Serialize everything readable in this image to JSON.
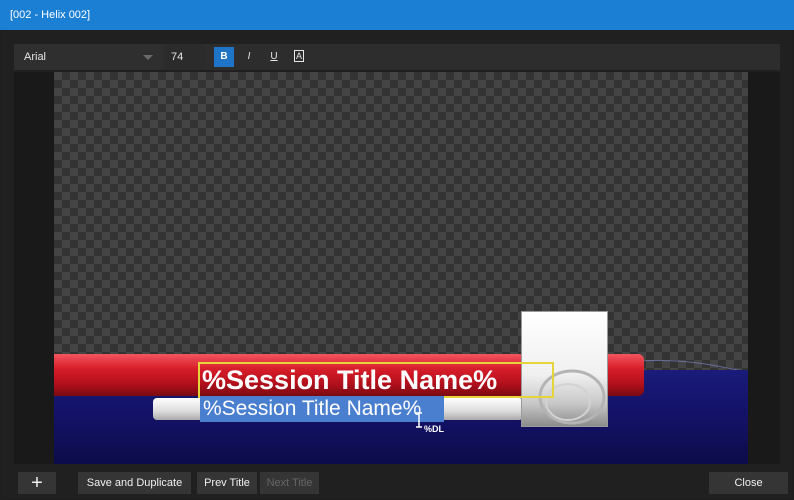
{
  "window": {
    "title": "[002 - Helix 002]"
  },
  "toolbar": {
    "font": "Arial",
    "size": "74",
    "bold_label": "B",
    "italic_label": "I",
    "underline_label": "U",
    "outline_label": "A"
  },
  "canvas": {
    "title_text": "%Session Title Name%",
    "subtitle_text": "%Session Title Name%",
    "dl_label": "%DL"
  },
  "footer": {
    "add_label": "+",
    "save_duplicate_label": "Save and Duplicate",
    "prev_title_label": "Prev Title",
    "next_title_label": "Next Title",
    "close_label": "Close"
  },
  "colors": {
    "titlebar": "#1b7fd4",
    "accent": "#1e74c6",
    "selection_box": "#e4d53a"
  },
  "icons": [
    "dropdown-caret-icon",
    "text-cursor-icon",
    "plus-icon"
  ]
}
